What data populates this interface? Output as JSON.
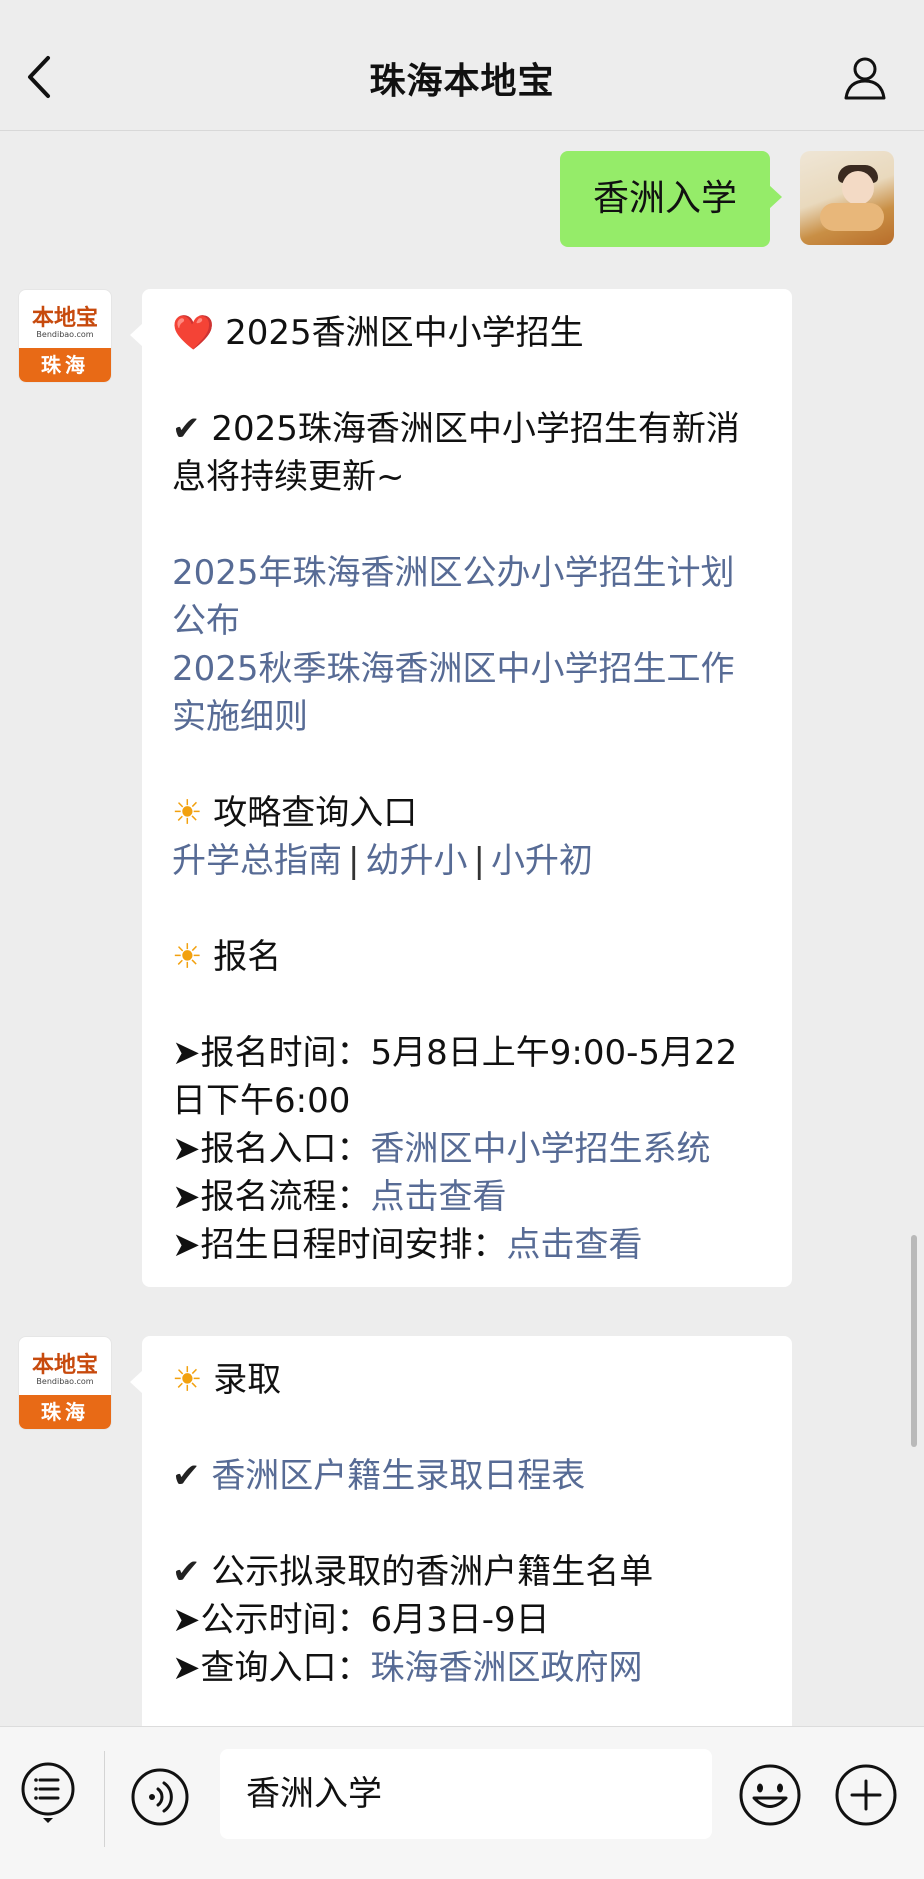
{
  "header": {
    "title": "珠海本地宝"
  },
  "outgoing": {
    "text": "香洲入学"
  },
  "bot": {
    "logo_top": "本地宝",
    "logo_sub": "Bendibao.com",
    "logo_band": "珠海"
  },
  "message1": {
    "title_icon": "❤️",
    "title": "2025香洲区中小学招生",
    "check_icon": "✔",
    "update_text": "2025珠海香洲区中小学招生有新消息将持续更新~",
    "links": [
      "2025年珠海香洲区公办小学招生计划公布",
      "2025秋季珠海香洲区中小学招生工作实施细则"
    ],
    "sun_icon": "☀",
    "guide_title": "攻略查询入口",
    "guide_links": [
      "升学总指南",
      "幼升小",
      "小升初"
    ],
    "guide_sep": "|",
    "signup_title": "报名",
    "arrow": "➤",
    "signup_time_label": "报名时间：",
    "signup_time_value": "5月8日上午9:00-5月22日下午6:00",
    "signup_entry_label": "报名入口：",
    "signup_entry_link": "香洲区中小学招生系统",
    "signup_flow_label": "报名流程：",
    "signup_flow_link": "点击查看",
    "schedule_label": "招生日程时间安排：",
    "schedule_link": "点击查看"
  },
  "message2": {
    "sun_icon": "☀",
    "title": "录取",
    "check_icon": "✔",
    "schedule_link": "香洲区户籍生录取日程表",
    "publicity_title": "公示拟录取的香洲户籍生名单",
    "arrow": "➤",
    "publicity_time_label": "公示时间：",
    "publicity_time_value": "6月3日-9日",
    "query_label": "查询入口：",
    "query_link": "珠海香洲区政府网"
  },
  "input": {
    "value": "香洲入学"
  },
  "icons": {
    "back": "chevron-left-icon",
    "profile": "person-icon",
    "menu": "list-menu-icon",
    "voice": "voice-icon",
    "emoji": "smiley-icon",
    "plus": "plus-icon"
  }
}
